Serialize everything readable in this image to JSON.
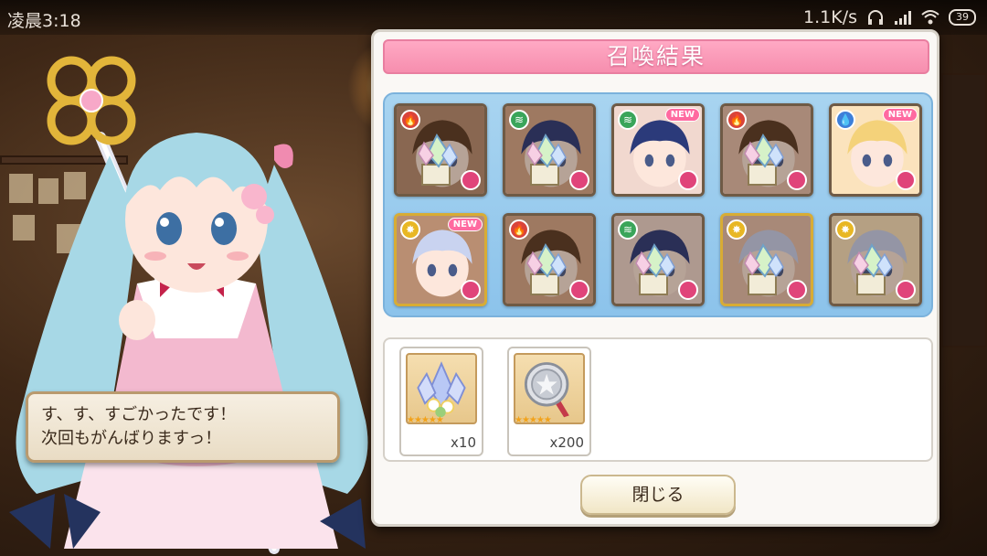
{
  "status_bar": {
    "time": "凌晨3:18",
    "network_speed": "1.1K/s",
    "battery": "39",
    "icons": [
      "headphones-icon",
      "signal-icon",
      "wifi-icon",
      "battery-icon"
    ]
  },
  "speech_bubble": {
    "line1": "す、す、すごかったです！",
    "line2": "次回もがんばりますっ！"
  },
  "result_panel": {
    "title": "召喚結果",
    "characters": [
      {
        "element": "fire",
        "is_new": false,
        "converted_to_crystal": true
      },
      {
        "element": "wind",
        "is_new": false,
        "converted_to_crystal": true
      },
      {
        "element": "wind",
        "is_new": true,
        "converted_to_crystal": false
      },
      {
        "element": "fire",
        "is_new": false,
        "converted_to_crystal": true
      },
      {
        "element": "water",
        "is_new": true,
        "converted_to_crystal": false
      },
      {
        "element": "light",
        "is_new": true,
        "converted_to_crystal": false,
        "rarity": "gold"
      },
      {
        "element": "fire",
        "is_new": false,
        "converted_to_crystal": true
      },
      {
        "element": "wind",
        "is_new": false,
        "converted_to_crystal": true
      },
      {
        "element": "light",
        "is_new": false,
        "converted_to_crystal": true,
        "rarity": "gold"
      },
      {
        "element": "light",
        "is_new": false,
        "converted_to_crystal": true
      }
    ],
    "new_label": "NEW",
    "items": [
      {
        "name": "crystal-bouquet",
        "stars": 5,
        "qty": "x10"
      },
      {
        "name": "silver-medal",
        "stars": 5,
        "qty": "x200"
      }
    ],
    "close_button": "閉じる"
  },
  "colors": {
    "title_pink": "#f68eae",
    "chars_box_blue": "#8cc3eb",
    "fire": "#d9443a",
    "wind": "#3aa55a",
    "water": "#3d7fd9",
    "light": "#e8b724"
  }
}
